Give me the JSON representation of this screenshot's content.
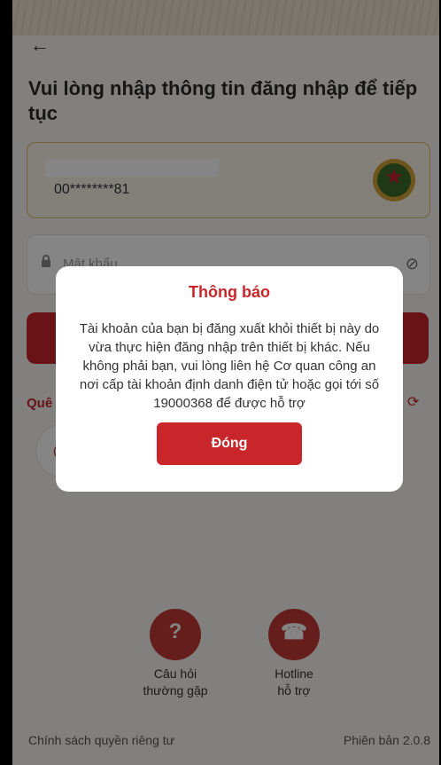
{
  "header": {
    "title": "Vui lòng nhập thông tin đăng nhập để tiếp tục"
  },
  "account": {
    "number": "00********81"
  },
  "password": {
    "placeholder": "Mật khẩu"
  },
  "links": {
    "forgot_partial": "Quê"
  },
  "dialog": {
    "title": "Thông báo",
    "message": "Tài khoản của bạn bị đăng xuất khỏi thiết bị này do vừa thực hiện đăng nhập trên thiết bị khác. Nếu không phải bạn, vui lòng liên hệ Cơ quan công an nơi cấp tài khoản định danh điện tử hoặc gọi tới số 19000368 để được hỗ trợ",
    "close_label": "Đóng"
  },
  "support": {
    "faq": [
      "Câu hỏi",
      "thường gặp"
    ],
    "hotline": [
      "Hotline",
      "hỗ trợ"
    ]
  },
  "footer": {
    "privacy": "Chính sách quyền riêng tư",
    "version": "Phiên bản 2.0.8"
  },
  "colors": {
    "accent": "#c9262c",
    "gold": "#d9b96a"
  },
  "icons": [
    "back-arrow-icon",
    "police-emblem-icon",
    "lock-icon",
    "eye-off-icon",
    "refresh-icon",
    "fingerprint-icon",
    "question-icon",
    "hotline-icon"
  ]
}
